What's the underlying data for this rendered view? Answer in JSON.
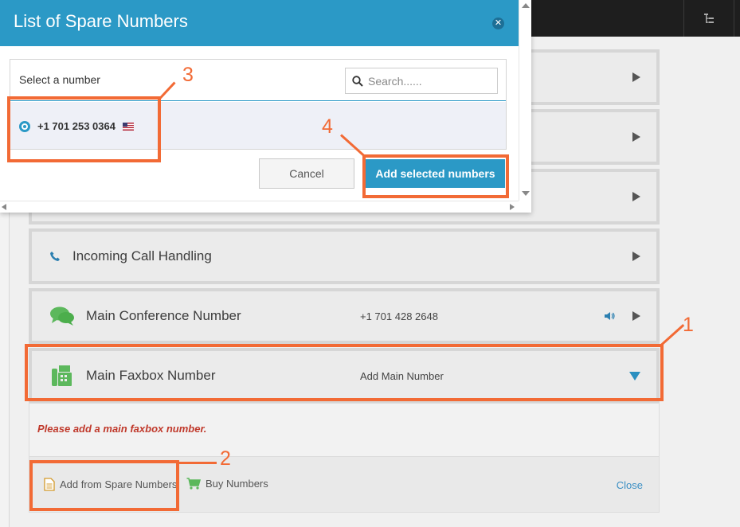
{
  "modal": {
    "title": "List of Spare Numbers",
    "select_title": "Select a number",
    "search_placeholder": "Search......",
    "options": [
      {
        "number": "+1 701 253 0364",
        "selected": true
      }
    ],
    "cancel_label": "Cancel",
    "add_label": "Add selected numbers"
  },
  "rows": [
    {
      "label": "Incoming Call Handling"
    },
    {
      "label": "Main Conference Number",
      "value": "+1 701 428 2648"
    },
    {
      "label": "Main Faxbox Number",
      "value": "Add Main Number"
    }
  ],
  "expanded": {
    "message": "Please add a main faxbox number.",
    "add_spare_label": "Add from Spare Numbers",
    "buy_label": "Buy Numbers",
    "close_label": "Close"
  },
  "annotations": [
    "1",
    "2",
    "3",
    "4"
  ],
  "colors": {
    "accent": "#2b99c6",
    "annotation": "#f26a35",
    "error": "#c0392b",
    "icon_green": "#5cb85c"
  }
}
